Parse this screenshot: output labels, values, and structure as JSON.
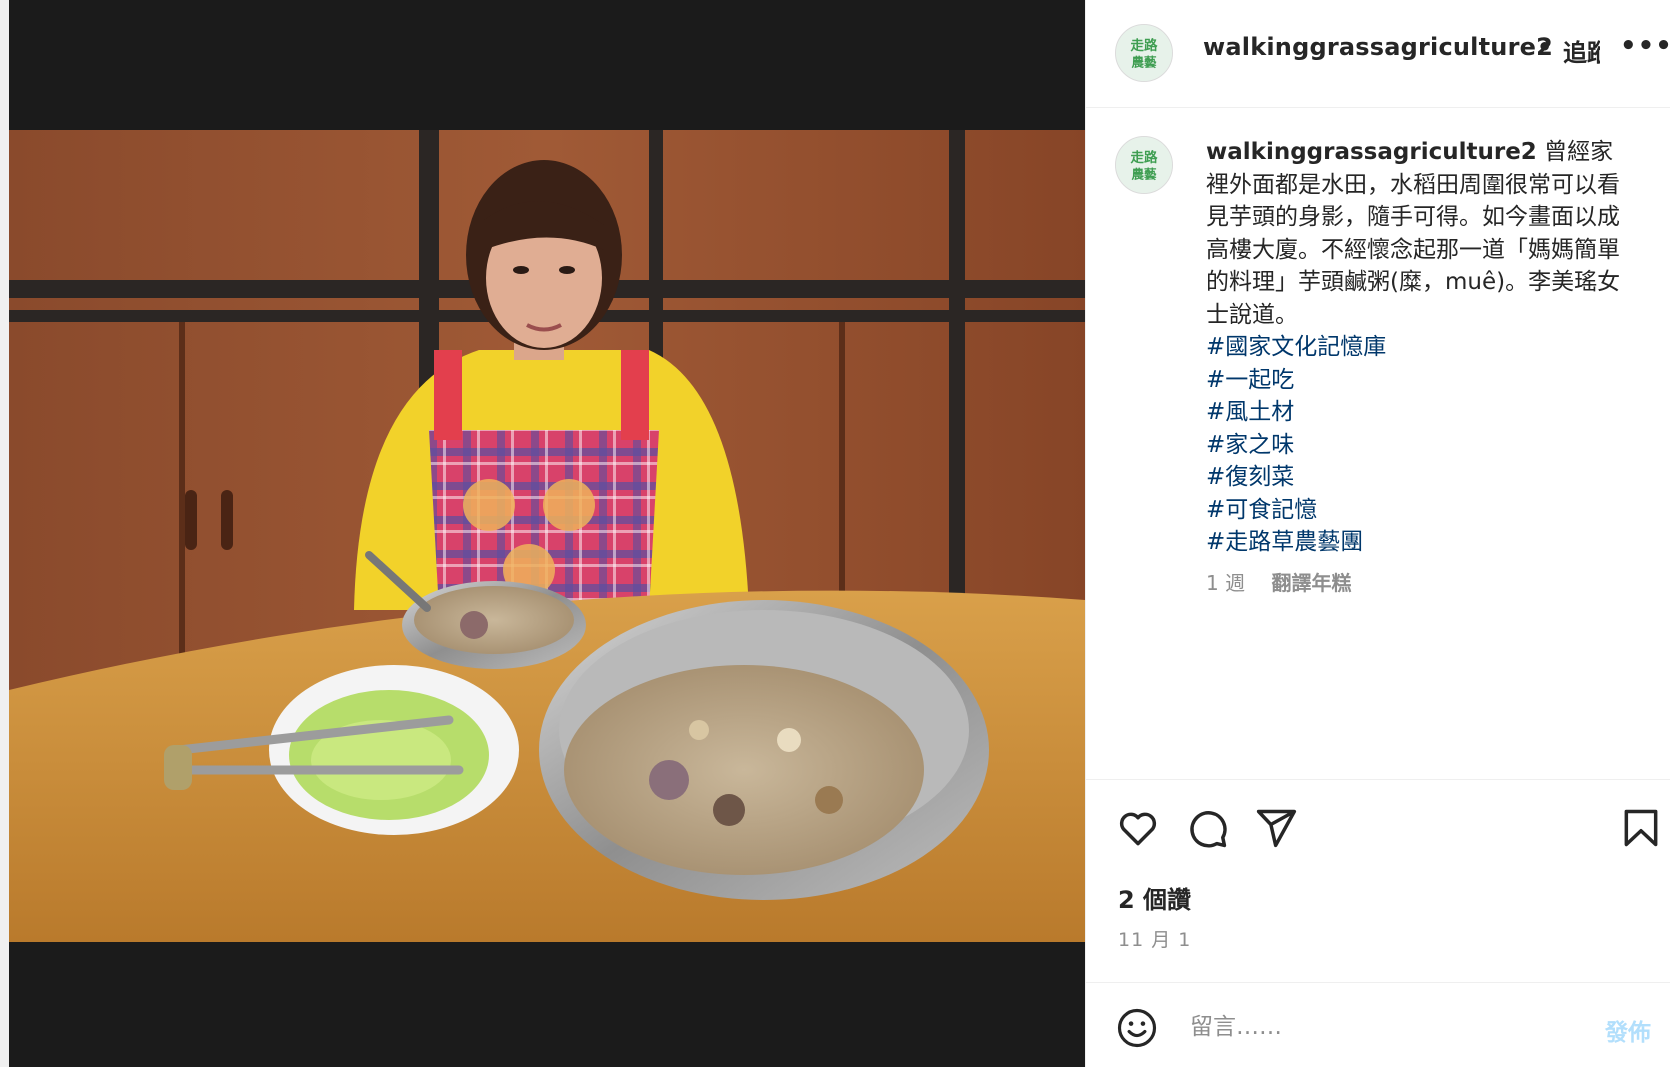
{
  "post": {
    "username": "walkinggrassagriculture2",
    "header_separator": "•",
    "follow_label": "追蹤",
    "more_label": "•••",
    "caption_text": "曾經家裡外面都是水田，水稻田周圍很常可以看見芋頭的身影，隨手可得。如今畫面以成高樓大廈。不經懷念起那一道「媽媽簡單的料理」芋頭鹹粥(糜，muê)。李美瑤女士說道。",
    "hashtags": [
      "#國家文化記憶庫",
      "#一起吃",
      "#風土材",
      "#家之味",
      "#復刻菜",
      "#可食記憶",
      "#走路草農藝團"
    ],
    "caption_time": "1 週",
    "translate_label": "翻譯年糕",
    "likes": "2 個讚",
    "date": "11 月 1",
    "comment_placeholder": "留言……",
    "post_button": "發佈"
  },
  "avatar": {
    "text_top": "走路",
    "text_bottom": "農藝"
  },
  "colors": {
    "hashtag": "#00376b",
    "secondary_text": "#8e8e8e",
    "post_button_disabled": "#b2dffc",
    "avatar_green": "#3f9e52"
  },
  "icons": [
    "heart-icon",
    "comment-icon",
    "share-icon",
    "bookmark-icon",
    "emoji-icon",
    "more-icon"
  ]
}
